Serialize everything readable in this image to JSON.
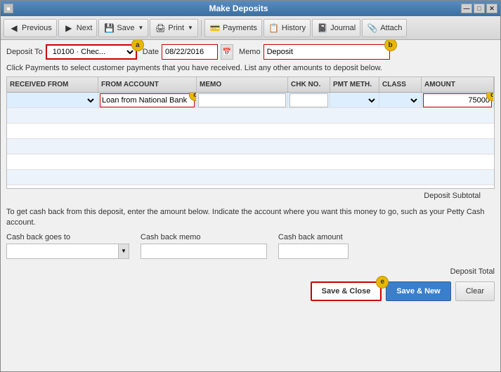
{
  "window": {
    "title": "Make Deposits",
    "controls": [
      "—",
      "□",
      "✕"
    ]
  },
  "toolbar": {
    "buttons": [
      {
        "id": "previous",
        "label": "Previous",
        "icon": "◀"
      },
      {
        "id": "next",
        "label": "Next",
        "icon": "▶"
      },
      {
        "id": "save",
        "label": "Save",
        "icon": "💾",
        "has_arrow": true
      },
      {
        "id": "print",
        "label": "Print",
        "icon": "🖨",
        "has_arrow": true
      },
      {
        "id": "payments",
        "label": "Payments",
        "icon": "💳"
      },
      {
        "id": "history",
        "label": "History",
        "icon": "📋"
      },
      {
        "id": "journal",
        "label": "Journal",
        "icon": "📓"
      },
      {
        "id": "attach",
        "label": "Attach",
        "icon": "📎"
      }
    ]
  },
  "form": {
    "deposit_to_label": "Deposit To",
    "deposit_to_value": "10100 · Chec...",
    "date_label": "Date",
    "date_value": "08/22/2016",
    "memo_label": "Memo",
    "memo_value": "Deposit"
  },
  "instruction": "Click Payments to select customer payments that you have received. List any other amounts to deposit below.",
  "table": {
    "headers": [
      "RECEIVED FROM",
      "FROM ACCOUNT",
      "MEMO",
      "CHK NO.",
      "PMT METH.",
      "CLASS",
      "AMOUNT"
    ],
    "rows": [
      {
        "received_from": "",
        "from_account": "Loan from National Bank",
        "memo": "",
        "chk_no": "",
        "pmt_meth": "",
        "class": "",
        "amount": "75000"
      }
    ]
  },
  "deposit_subtotal_label": "Deposit Subtotal",
  "cash_section": {
    "instructions": "To get cash back from this deposit, enter the amount below.  Indicate the account where you want this money to go, such as your Petty Cash account.",
    "cash_goes_to_label": "Cash back goes to",
    "cash_memo_label": "Cash back memo",
    "cash_amount_label": "Cash back amount"
  },
  "deposit_total_label": "Deposit Total",
  "buttons": {
    "save_close": "Save & Close",
    "save_new": "Save & New",
    "clear": "Clear"
  },
  "badges": {
    "a": "a",
    "b": "b",
    "c": "c",
    "d": "d",
    "e": "e"
  }
}
